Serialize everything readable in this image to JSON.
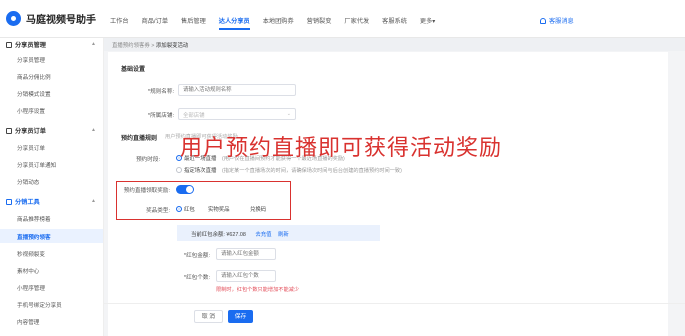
{
  "app": {
    "name": "马庭视频号助手"
  },
  "nav": [
    "工作台",
    "商品/订单",
    "售后管理",
    "达人分享员",
    "本地团购券",
    "营销裂变",
    "厂家代发",
    "客服系统",
    "更多▾"
  ],
  "nav_active_index": 3,
  "service": "客服消息",
  "sidebar": {
    "sec1": "分享员管理",
    "sec1_items": [
      "分享员管理",
      "商品分佣比例",
      "分销模式设置",
      "小程序设置"
    ],
    "sec2": "分享员订单",
    "sec2_items": [
      "分享员订单",
      "分享员订单通知",
      "分销动态"
    ],
    "sec3": "分销工具",
    "sec3_items": [
      "商品推荐榜着",
      "直播预约领客",
      "秒视频裂变",
      "素材中心",
      "小程序管理",
      "手机号绑定分享员",
      "内容管理"
    ]
  },
  "breadcrumb": {
    "parent": "直播预约领客券",
    "sep": ">",
    "current": "添加裂变活动"
  },
  "form": {
    "basic_title": "基础设置",
    "rule_name_label": "*规则名称:",
    "rule_name_placeholder": "请输入活动规则名称",
    "store_label": "*所属店铺:",
    "store_placeholder": "全部店铺",
    "reserve_title": "预约直播规则",
    "reserve_hint": "用户预约直播即可获得活动奖励",
    "period_label": "预约时段:",
    "period_opt1": "最近一场直播",
    "period_opt1_desc": "(用户仅在直播间预约才能获得一个最近场直播的奖励)",
    "period_opt2": "指定场次直播",
    "period_opt2_desc": "(指定某一个直播场次的时间，请确保场次时间与后台创建的直播预约时间一致)",
    "reward_label": "预约直播领取奖励:",
    "type_label": "奖品类型:",
    "type_opts": [
      "红包",
      "实物奖品",
      "兑换码"
    ],
    "balance": "当前红包余额: ¥627.08",
    "balance_link1": "去充值",
    "balance_link2": "刷新",
    "amount_label": "*红包金额:",
    "amount_placeholder": "请输入红包金额",
    "count_label": "*红包个数:",
    "count_placeholder": "请输入红包个数",
    "count_error": "限制时，红包个数只能增加不能减少",
    "cancel": "取 消",
    "save": "保存"
  },
  "overlay_text": "用户预约直播即可获得活动奖励",
  "colors": {
    "accent": "#1a6cf0",
    "annotation": "#d9322f"
  }
}
